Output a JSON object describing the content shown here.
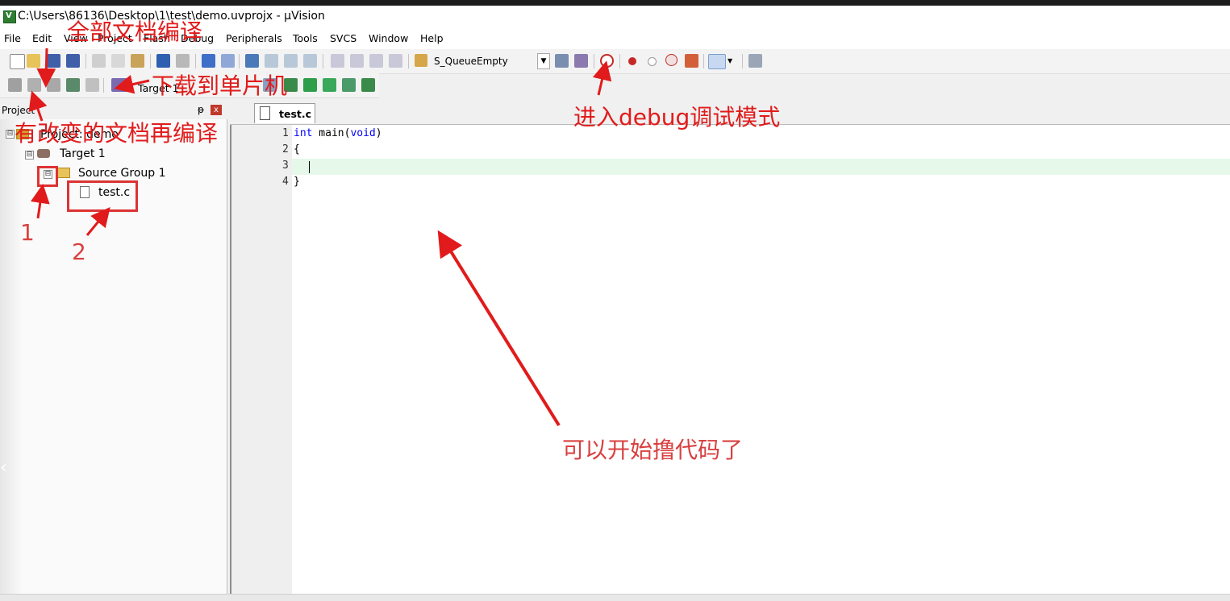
{
  "window": {
    "title": "C:\\Users\\86136\\Desktop\\1\\test\\demo.uvprojx - µVision",
    "app_icon_letter": "V"
  },
  "menu": [
    "File",
    "Edit",
    "View",
    "Project",
    "Flash",
    "Debug",
    "Peripherals",
    "Tools",
    "SVCS",
    "Window",
    "Help"
  ],
  "toolbar1": {
    "target_name": "S_QueueEmpty"
  },
  "toolbar2": {
    "target_label": "Target 1"
  },
  "project_panel": {
    "title": "Project",
    "pin": "ᵽ",
    "close": "x"
  },
  "tree": {
    "root": "Project: demo",
    "target": "Target 1",
    "group": "Source Group 1",
    "file": "test.c"
  },
  "editor": {
    "tab": "test.c",
    "lines": [
      {
        "num": "1",
        "code": "int main(void)"
      },
      {
        "num": "2",
        "code": "{"
      },
      {
        "num": "3",
        "code": ""
      },
      {
        "num": "4",
        "code": "}"
      }
    ]
  },
  "annotations": {
    "rebuild_all": "全部文档编译",
    "download": "下载到单片机",
    "build_changed": "有改变的文档再编译",
    "debug_mode": "进入debug调试模式",
    "start_coding": "可以开始撸代码了",
    "num1": "1",
    "num2": "2"
  },
  "colors": {
    "annotation_red": "#e11b1b",
    "current_line": "#e6f8e9",
    "keyword_blue": "#0000ff"
  }
}
